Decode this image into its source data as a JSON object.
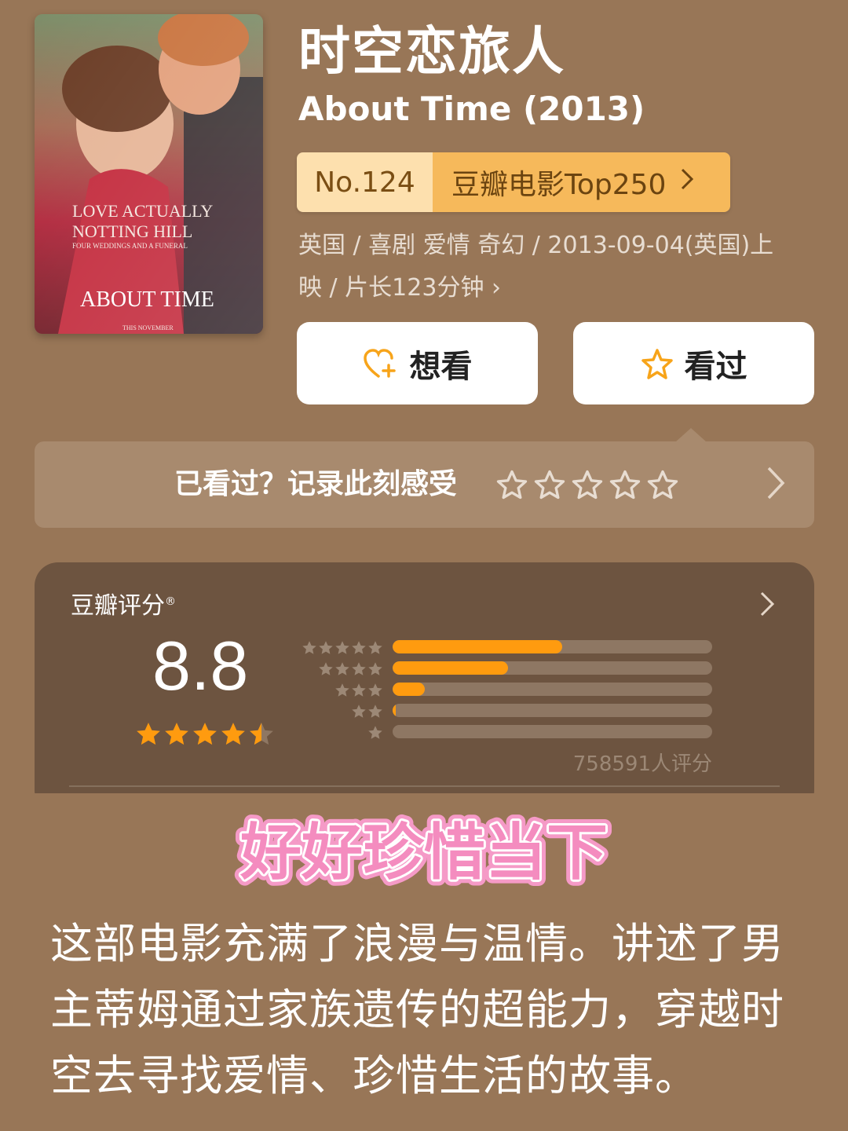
{
  "movie": {
    "title": "时空恋旅人",
    "subtitle": "About Time (2013)",
    "poster": {
      "line1": "LOVE ACTUALLY",
      "line2": "NOTTING HILL",
      "line3": "FOUR WEDDINGS AND A FUNERAL",
      "title": "ABOUT TIME",
      "footer": "THIS NOVEMBER"
    },
    "rank_number": "No.124",
    "rank_list": "豆瓣电影Top250",
    "meta_line1": "英国 / 喜剧 爱情 奇幻 / 2013-09-04(英国)上",
    "meta_line2": "映 / 片长123分钟 ›"
  },
  "actions": {
    "want_label": "想看",
    "want_icon": "heart-plus-icon",
    "seen_label": "看过",
    "seen_icon": "star-outline-icon"
  },
  "record": {
    "prompt": "已看过？记录此刻感受",
    "star_count": 5
  },
  "rating": {
    "label": "豆瓣评分",
    "registered_mark": "®",
    "score": "8.8",
    "star_score": 4.5,
    "distribution": [
      {
        "stars": 5,
        "fraction": 0.53
      },
      {
        "stars": 4,
        "fraction": 0.36
      },
      {
        "stars": 3,
        "fraction": 0.1
      },
      {
        "stars": 2,
        "fraction": 0.01
      },
      {
        "stars": 1,
        "fraction": 0.0
      }
    ],
    "count_text": "758591人评分"
  },
  "caption": {
    "headline": "好好珍惜当下",
    "body": "这部电影充满了浪漫与温情。讲述了男主蒂姆通过家族遗传的超能力，穿越时空去寻找爱情、珍惜生活的故事。"
  },
  "colors": {
    "background": "#987657",
    "accent_orange": "#ff9b0f",
    "headline_pink": "#f7a6d0"
  }
}
